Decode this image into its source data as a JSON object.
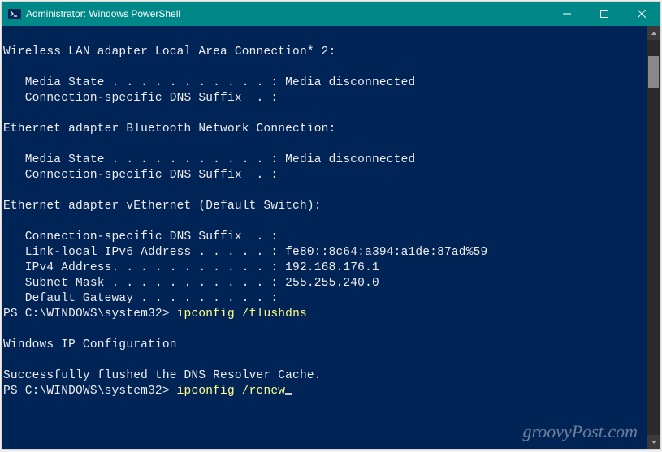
{
  "window": {
    "title": "Administrator: Windows PowerShell"
  },
  "terminal": {
    "lines": [
      "",
      "Wireless LAN adapter Local Area Connection* 2:",
      "",
      "   Media State . . . . . . . . . . . : Media disconnected",
      "   Connection-specific DNS Suffix  . :",
      "",
      "Ethernet adapter Bluetooth Network Connection:",
      "",
      "   Media State . . . . . . . . . . . : Media disconnected",
      "   Connection-specific DNS Suffix  . :",
      "",
      "Ethernet adapter vEthernet (Default Switch):",
      "",
      "   Connection-specific DNS Suffix  . :",
      "   Link-local IPv6 Address . . . . . : fe80::8c64:a394:a1de:87ad%59",
      "   IPv4 Address. . . . . . . . . . . : 192.168.176.1",
      "   Subnet Mask . . . . . . . . . . . : 255.255.240.0",
      "   Default Gateway . . . . . . . . . :"
    ],
    "prompt1_path": "PS C:\\WINDOWS\\system32> ",
    "prompt1_cmd": "ipconfig /flushdns",
    "after_flush": [
      "",
      "Windows IP Configuration",
      "",
      "Successfully flushed the DNS Resolver Cache."
    ],
    "prompt2_path": "PS C:\\WINDOWS\\system32> ",
    "prompt2_cmd": "ipconfig /renew"
  },
  "watermark": "groovyPost.com"
}
